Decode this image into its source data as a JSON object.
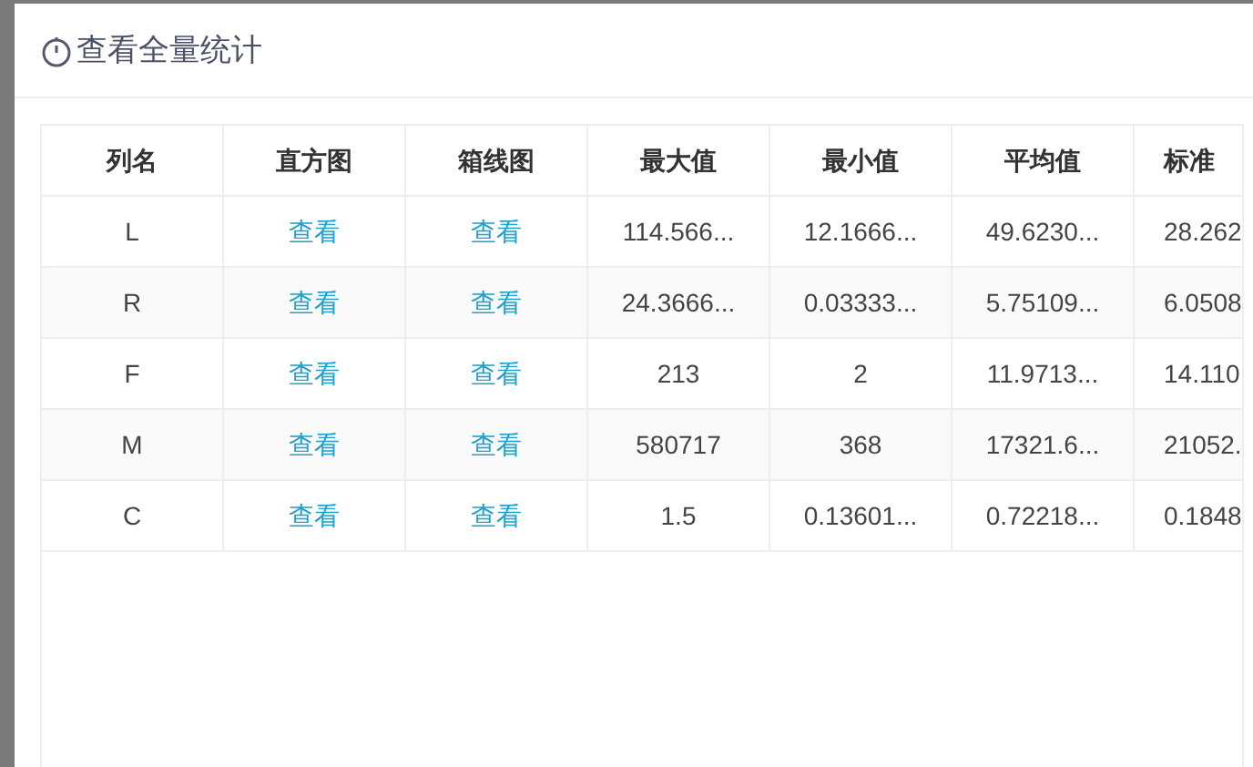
{
  "dialog": {
    "title": "查看全量统计"
  },
  "table": {
    "columns": [
      "列名",
      "直方图",
      "箱线图",
      "最大值",
      "最小值",
      "平均值",
      "标准"
    ],
    "rows": [
      {
        "name": "L",
        "histogram": "查看",
        "boxplot": "查看",
        "max": "114.566...",
        "min": "12.1666...",
        "mean": "49.6230...",
        "std": "28.262"
      },
      {
        "name": "R",
        "histogram": "查看",
        "boxplot": "查看",
        "max": "24.3666...",
        "min": "0.03333...",
        "mean": "5.75109...",
        "std": "6.0508"
      },
      {
        "name": "F",
        "histogram": "查看",
        "boxplot": "查看",
        "max": "213",
        "min": "2",
        "mean": "11.9713...",
        "std": "14.110"
      },
      {
        "name": "M",
        "histogram": "查看",
        "boxplot": "查看",
        "max": "580717",
        "min": "368",
        "mean": "17321.6...",
        "std": "21052."
      },
      {
        "name": "C",
        "histogram": "查看",
        "boxplot": "查看",
        "max": "1.5",
        "min": "0.13601...",
        "mean": "0.72218...",
        "std": "0.1848"
      }
    ]
  }
}
